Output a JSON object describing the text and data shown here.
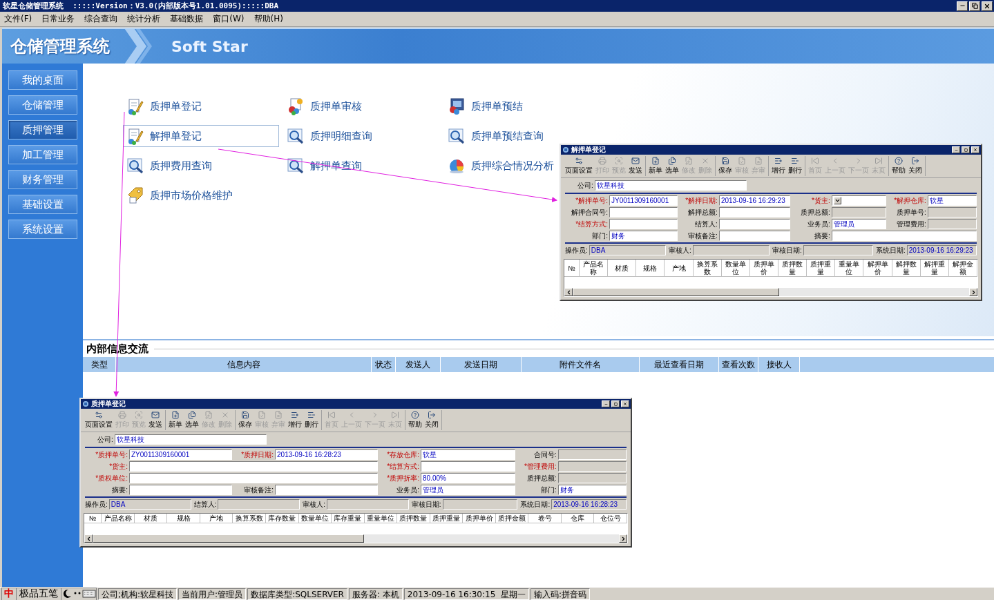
{
  "window": {
    "title": "软星仓储管理系统  :::::Version：V3.0(内部版本号1.01.0095):::::DBA"
  },
  "menu": [
    "文件(F)",
    "日常业务",
    "综合查询",
    "统计分析",
    "基础数据",
    "窗口(W)",
    "帮助(H)"
  ],
  "banner": {
    "logo": "仓储管理系统",
    "brand": "Soft Star"
  },
  "sidebar": {
    "items": [
      {
        "label": "我的桌面",
        "selected": false
      },
      {
        "label": "仓储管理",
        "selected": false
      },
      {
        "label": "质押管理",
        "selected": true
      },
      {
        "label": "加工管理",
        "selected": false
      },
      {
        "label": "财务管理",
        "selected": false
      },
      {
        "label": "基础设置",
        "selected": false
      },
      {
        "label": "系统设置",
        "selected": false
      }
    ]
  },
  "modules": {
    "items": [
      {
        "label": "质押单登记",
        "kind": "form",
        "selected": false
      },
      {
        "label": "质押单审核",
        "kind": "review",
        "selected": false
      },
      {
        "label": "质押单预结",
        "kind": "settle",
        "selected": false
      },
      {
        "label": "解押单登记",
        "kind": "form",
        "selected": true
      },
      {
        "label": "质押明细查询",
        "kind": "search",
        "selected": false
      },
      {
        "label": "质押单预结查询",
        "kind": "search",
        "selected": false
      },
      {
        "label": "质押费用查询",
        "kind": "search",
        "selected": false
      },
      {
        "label": "解押单查询",
        "kind": "search",
        "selected": false
      },
      {
        "label": "质押综合情况分析",
        "kind": "pie",
        "selected": false
      },
      {
        "label": "质押市场价格维护",
        "kind": "tag",
        "selected": false
      }
    ]
  },
  "messages": {
    "title": "内部信息交流",
    "columns": [
      "类型",
      "信息内容",
      "状态",
      "发送人",
      "发送日期",
      "附件文件名",
      "最近查看日期",
      "查看次数",
      "接收人"
    ]
  },
  "windows": [
    {
      "title": "解押单登记",
      "toolbar": [
        {
          "buttons": [
            {
              "label": "页面设置",
              "kind": "setup",
              "disabled": false
            },
            {
              "label": "打印",
              "kind": "print",
              "disabled": true
            },
            {
              "label": "预览",
              "kind": "preview",
              "disabled": true
            },
            {
              "label": "发送",
              "kind": "send",
              "disabled": false
            }
          ]
        },
        {
          "buttons": [
            {
              "label": "新单",
              "kind": "new",
              "disabled": false
            },
            {
              "label": "选单",
              "kind": "pick",
              "disabled": false
            },
            {
              "label": "修改",
              "kind": "edit",
              "disabled": true
            },
            {
              "label": "删除",
              "kind": "delete",
              "disabled": true
            }
          ]
        },
        {
          "buttons": [
            {
              "label": "保存",
              "kind": "save",
              "disabled": false
            },
            {
              "label": "审核",
              "kind": "approve",
              "disabled": true
            },
            {
              "label": "弃审",
              "kind": "unapprove",
              "disabled": true
            }
          ]
        },
        {
          "buttons": [
            {
              "label": "增行",
              "kind": "addrow",
              "disabled": false
            },
            {
              "label": "删行",
              "kind": "delrow",
              "disabled": false
            }
          ]
        },
        {
          "buttons": [
            {
              "label": "首页",
              "kind": "first",
              "disabled": true
            },
            {
              "label": "上一页",
              "kind": "prev",
              "disabled": true
            },
            {
              "label": "下一页",
              "kind": "next",
              "disabled": true
            },
            {
              "label": "末页",
              "kind": "last",
              "disabled": true
            }
          ]
        },
        {
          "buttons": [
            {
              "label": "帮助",
              "kind": "help",
              "disabled": false
            },
            {
              "label": "关闭",
              "kind": "close",
              "disabled": false
            }
          ]
        }
      ],
      "company": {
        "label": "公司:",
        "value": "软星科技"
      },
      "rows": [
        [
          {
            "label": "*解押单号:",
            "value": "JY0011309160001",
            "required": true,
            "readonly": false,
            "kind": "text"
          },
          {
            "label": "*解押日期:",
            "value": "2013-09-16 16:29:23",
            "required": true,
            "readonly": false,
            "kind": "text"
          },
          {
            "label": "*货主:",
            "required": true,
            "readonly": false,
            "kind": "select"
          },
          {
            "label": "*解押仓库:",
            "value": "软星",
            "required": true,
            "readonly": false,
            "kind": "text"
          }
        ],
        [
          {
            "label": "解押合同号:",
            "required": false,
            "readonly": false,
            "kind": "text"
          },
          {
            "label": "解押总额:",
            "required": false,
            "readonly": false,
            "kind": "text"
          },
          {
            "label": "质押总额:",
            "required": false,
            "readonly": true,
            "kind": "text"
          },
          {
            "label": "质押单号:",
            "required": false,
            "readonly": true,
            "kind": "text"
          }
        ],
        [
          {
            "label": "*结算方式:",
            "required": true,
            "readonly": false,
            "kind": "text"
          },
          {
            "label": "结算人:",
            "required": false,
            "readonly": false,
            "kind": "text"
          },
          {
            "label": "业务员:",
            "value": "管理员",
            "required": false,
            "readonly": false,
            "kind": "text"
          },
          {
            "label": "管理费用:",
            "required": false,
            "readonly": true,
            "kind": "text"
          }
        ],
        [
          {
            "label": "部门:",
            "value": "财务",
            "required": false,
            "readonly": false,
            "kind": "text"
          },
          {
            "label": "审核备注:",
            "required": false,
            "readonly": false,
            "kind": "text"
          },
          {
            "label": "摘要:",
            "required": false,
            "readonly": false,
            "kind": "wide"
          }
        ]
      ],
      "footer": [
        {
          "label": "操作员:",
          "value": "DBA"
        },
        {
          "label": "审核人:"
        },
        {
          "label": "审核日期:"
        },
        {
          "label": "系统日期:",
          "value": "2013-09-16 16:29:23"
        }
      ],
      "grid": {
        "columns": [
          "№",
          "产品名称",
          "材质",
          "规格",
          "产地",
          "换算系数",
          "数量单位",
          "质押单价",
          "质押数量",
          "质押重量",
          "重量单位",
          "解押单价",
          "解押数量",
          "解押重量",
          "解押金额"
        ]
      }
    },
    {
      "title": "质押单登记",
      "toolbar": [
        {
          "buttons": [
            {
              "label": "页面设置",
              "kind": "setup",
              "disabled": false
            },
            {
              "label": "打印",
              "kind": "print",
              "disabled": true
            },
            {
              "label": "预览",
              "kind": "preview",
              "disabled": true
            },
            {
              "label": "发送",
              "kind": "send",
              "disabled": false
            }
          ]
        },
        {
          "buttons": [
            {
              "label": "新单",
              "kind": "new",
              "disabled": false
            },
            {
              "label": "选单",
              "kind": "pick",
              "disabled": false
            },
            {
              "label": "修改",
              "kind": "edit",
              "disabled": true
            },
            {
              "label": "删除",
              "kind": "delete",
              "disabled": true
            }
          ]
        },
        {
          "buttons": [
            {
              "label": "保存",
              "kind": "save",
              "disabled": false
            },
            {
              "label": "审核",
              "kind": "approve",
              "disabled": true
            },
            {
              "label": "弃审",
              "kind": "unapprove",
              "disabled": true
            },
            {
              "label": "增行",
              "kind": "addrow",
              "disabled": false
            },
            {
              "label": "删行",
              "kind": "delrow",
              "disabled": false
            }
          ]
        },
        {
          "buttons": [
            {
              "label": "首页",
              "kind": "first",
              "disabled": true
            },
            {
              "label": "上一页",
              "kind": "prev",
              "disabled": true
            },
            {
              "label": "下一页",
              "kind": "next",
              "disabled": true
            },
            {
              "label": "末页",
              "kind": "last",
              "disabled": true
            }
          ]
        },
        {
          "buttons": [
            {
              "label": "帮助",
              "kind": "help",
              "disabled": false
            },
            {
              "label": "关闭",
              "kind": "close",
              "disabled": false
            }
          ]
        }
      ],
      "company": {
        "label": "公司:",
        "value": "软星科技"
      },
      "rows": [
        [
          {
            "label": "*质押单号:",
            "value": "ZY0011309160001",
            "required": true,
            "readonly": false,
            "kind": "text"
          },
          {
            "label": "*质押日期:",
            "value": "2013-09-16 16:28:23",
            "required": true,
            "readonly": false,
            "kind": "text"
          },
          {
            "label": "*存放仓库:",
            "value": "软星",
            "required": true,
            "readonly": false,
            "kind": "text"
          },
          {
            "label": "合同号:",
            "required": false,
            "readonly": true,
            "kind": "text"
          }
        ],
        [
          {
            "label": "*货主:",
            "required": true,
            "readonly": false,
            "kind": "wide"
          },
          {
            "label": "*结算方式:",
            "required": true,
            "readonly": false,
            "kind": "text"
          },
          {
            "label": "*管理费用:",
            "required": true,
            "readonly": true,
            "kind": "text"
          }
        ],
        [
          {
            "label": "*质权单位:",
            "required": true,
            "readonly": false,
            "kind": "wide"
          },
          {
            "label": "*质押折率:",
            "value": "80.00%",
            "required": true,
            "readonly": false,
            "kind": "text"
          },
          {
            "label": "质押总额:",
            "required": false,
            "readonly": true,
            "kind": "text"
          }
        ],
        [
          {
            "label": "摘要:",
            "required": false,
            "readonly": false,
            "kind": "text"
          },
          {
            "label": "审核备注:",
            "required": false,
            "readonly": false,
            "kind": "text"
          },
          {
            "label": "业务员:",
            "value": "管理员",
            "required": false,
            "readonly": false,
            "kind": "text"
          },
          {
            "label": "部门:",
            "value": "财务",
            "required": false,
            "readonly": false,
            "kind": "text"
          }
        ]
      ],
      "footer": [
        {
          "label": "操作员:",
          "value": "DBA"
        },
        {
          "label": "结算人:"
        },
        {
          "label": "审核人:"
        },
        {
          "label": "审核日期:"
        },
        {
          "label": "系统日期:",
          "value": "2013-09-16 16:28:23"
        }
      ],
      "grid": {
        "columns": [
          "№",
          "产品名称",
          "材质",
          "规格",
          "产地",
          "换算系数",
          "库存数量",
          "数量单位",
          "库存重量",
          "重量单位",
          "质押数量",
          "质押重量",
          "质押单价",
          "质押金额",
          "卷号",
          "仓库",
          "仓位号"
        ]
      }
    }
  ],
  "status_bar": {
    "ime": {
      "logo": "中",
      "name": "极品五笔"
    },
    "fields": [
      "公司;机构:软星科技",
      "当前用户:管理员",
      "数据库类型:SQLSERVER",
      "服务器: 本机",
      "2013-09-16 16:30:15  星期一",
      "输入码:拼音码"
    ]
  }
}
